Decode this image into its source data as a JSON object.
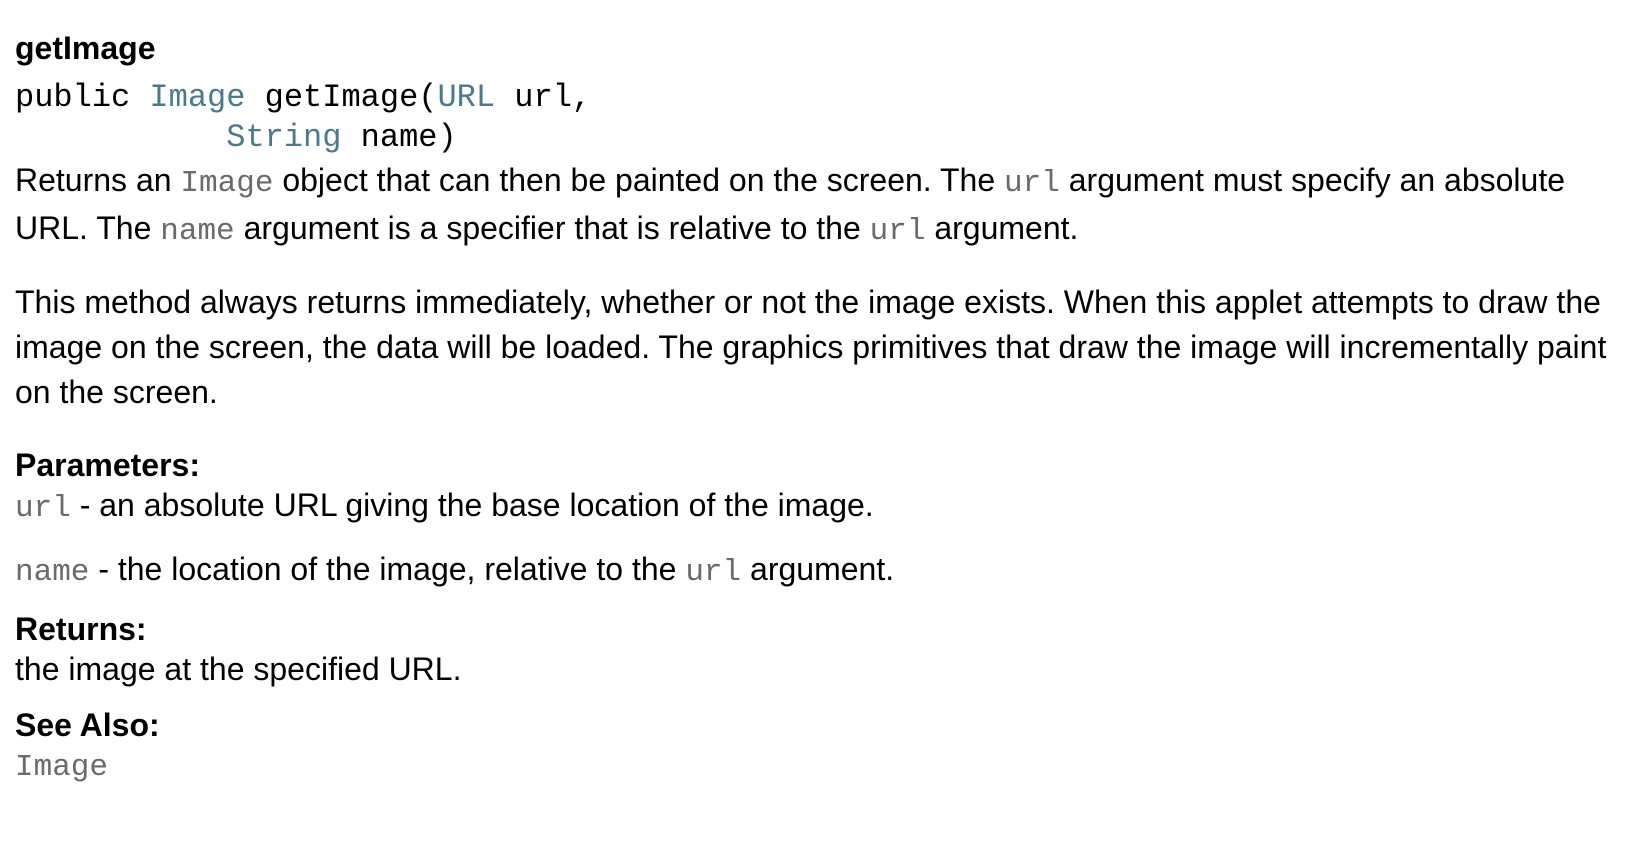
{
  "method": {
    "title": "getImage",
    "signature": {
      "modifier": "public",
      "return_type": "Image",
      "name_open": "getImage(",
      "param1_type": "URL",
      "param1_name": "url,",
      "param2_type": "String",
      "param2_name": "name)"
    },
    "description": {
      "p1": {
        "t1": "Returns an ",
        "c1": "Image",
        "t2": " object that can then be painted on the screen. The ",
        "c2": "url",
        "t3": " argument must specify an absolute URL. The ",
        "c3": "name",
        "t4": " argument is a specifier that is relative to the ",
        "c4": "url",
        "t5": " argument."
      },
      "p2": "This method always returns immediately, whether or not the image exists. When this applet attempts to draw the image on the screen, the data will be loaded. The graphics primitives that draw the image will incrementally paint on the screen."
    },
    "parameters": {
      "label": "Parameters:",
      "items": [
        {
          "code": "url",
          "text": " - an absolute URL giving the base location of the image."
        },
        {
          "code": "name",
          "text": " - the location of the image, relative to the ",
          "code2": "url",
          "text2": " argument."
        }
      ]
    },
    "returns": {
      "label": "Returns:",
      "text": "the image at the specified URL."
    },
    "see_also": {
      "label": "See Also:",
      "link": "Image"
    }
  }
}
